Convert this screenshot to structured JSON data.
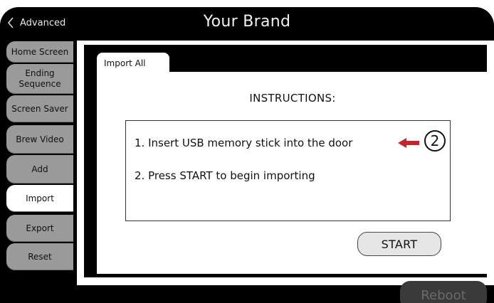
{
  "header": {
    "back_label": "Advanced",
    "brand_title": "Your Brand"
  },
  "sidebar": {
    "items": [
      {
        "label": "Home Screen",
        "active": false
      },
      {
        "label": "Ending Sequence",
        "active": false
      },
      {
        "label": "Screen Saver",
        "active": false
      },
      {
        "label": "Brew Video",
        "active": false
      },
      {
        "label": "Add",
        "active": false
      },
      {
        "label": "Import",
        "active": true
      },
      {
        "label": "Export",
        "active": false
      },
      {
        "label": "Reset",
        "active": false
      }
    ]
  },
  "panel": {
    "tab_label": "Import All",
    "instructions_title": "INSTRUCTIONS:",
    "steps": [
      "1.  Insert USB memory stick into the door",
      "2.  Press START to begin importing"
    ],
    "start_label": "START",
    "callout_number": "2"
  },
  "footer": {
    "reboot_label": "Reboot"
  },
  "colors": {
    "frame": "#000000",
    "tab_inactive": "#9a9a9a",
    "tab_active": "#ffffff",
    "callout_arrow": "#c0282b",
    "reboot_bg": "#3a3a3a"
  },
  "icons": [
    "chevron-left-icon",
    "red-arrow-icon",
    "circled-number-icon"
  ]
}
